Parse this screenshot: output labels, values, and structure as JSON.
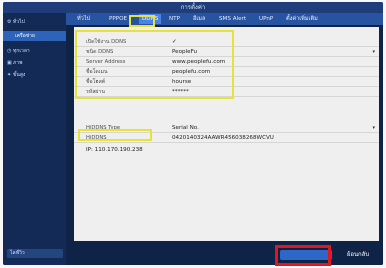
{
  "window": {
    "title": "การตั้งค่า"
  },
  "sidebar": {
    "items": [
      {
        "label": "ทั่วไป",
        "icon": "gear-icon"
      },
      {
        "label": "เครือข่าย",
        "icon": "network-icon"
      },
      {
        "label": "ทุกเวลา",
        "icon": "clock-icon"
      },
      {
        "label": "ภาพ",
        "icon": "image-icon"
      },
      {
        "label": "ขั้นสูง",
        "icon": "tools-icon"
      }
    ],
    "selected_index": 1,
    "bottom_label": "ไลฟ์วิว"
  },
  "tabs": [
    {
      "label": "ทั่วไป"
    },
    {
      "label": "PPPOE"
    },
    {
      "label": "DDNS",
      "active": true
    },
    {
      "label": "NTP"
    },
    {
      "label": "อีเมล"
    },
    {
      "label": "SMS Alert"
    },
    {
      "label": "UPnP"
    },
    {
      "label": "ตั้งค่าเพิ่มเติม"
    }
  ],
  "ddns": {
    "rows": [
      {
        "label": "เปิดใช้งาน DDNS",
        "value": "✓",
        "type": "checkbox"
      },
      {
        "label": "ชนิด DDNS",
        "value": "PeopleFu",
        "type": "select"
      },
      {
        "label": "Server Address",
        "value": "www.peoplefu.com"
      },
      {
        "label": "ชื่อโดเมน",
        "value": "peoplefu.com"
      },
      {
        "label": "ชื่อโฮสต์",
        "value": "hourse"
      },
      {
        "label": "รหัสผ่าน",
        "value": "******"
      }
    ]
  },
  "hiddns": {
    "rows": [
      {
        "label": "HiDDNS Type",
        "value": "Serial No.",
        "type": "select"
      },
      {
        "label": "HiDDNS",
        "value": "0420140324AAWR456038268WCVU"
      }
    ],
    "ip_label": "IP: 110.170.190.238"
  },
  "footer": {
    "apply_label": "",
    "back_label": "ย้อนกลับ"
  },
  "colors": {
    "highlight_yellow": "#e6e23a",
    "highlight_red": "#e2161f",
    "active_tab": "#4a83e3"
  }
}
